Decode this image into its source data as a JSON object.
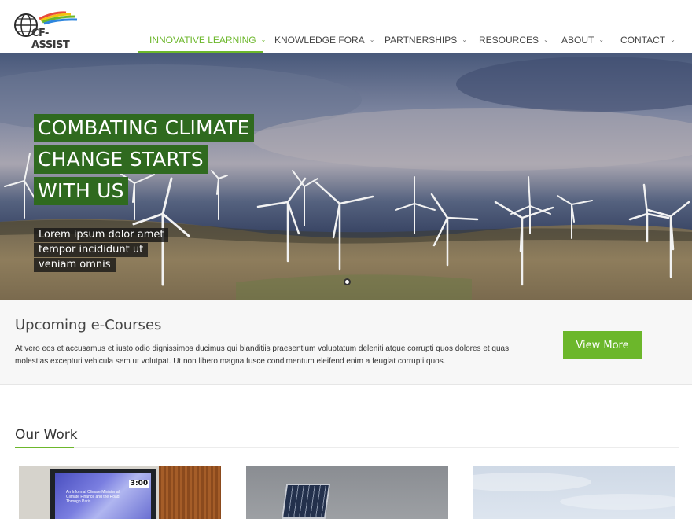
{
  "header": {
    "logo_text": "CF-ASSIST",
    "nav": [
      {
        "label": "INNOVATIVE LEARNING",
        "active": true
      },
      {
        "label": "KNOWLEDGE FORA",
        "active": false
      },
      {
        "label": "PARTNERSHIPS",
        "active": false
      },
      {
        "label": "RESOURCES",
        "active": false
      },
      {
        "label": "ABOUT",
        "active": false
      },
      {
        "label": "CONTACT",
        "active": false
      }
    ],
    "chevron_icon": "chevron-down-icon"
  },
  "hero": {
    "title_lines": [
      "COMBATING CLIMATE",
      "CHANGE STARTS",
      "WITH US"
    ],
    "subtitle_lines": [
      "Lorem ipsum dolor amet",
      "tempor incididunt ut",
      "veniam omnis"
    ],
    "slides": 1,
    "current_slide": 1
  },
  "courses": {
    "title": "Upcoming e-Courses",
    "text": "At vero eos et accusamus et iusto odio dignissimos ducimus qui blanditiis praesentium voluptatum deleniti atque corrupti quos dolores et quas molestias excepturi vehicula sem ut volutpat. Ut non libero magna fusce condimentum eleifend enim a feugiat corrupti quos.",
    "button_label": "View More"
  },
  "work": {
    "title": "Our Work",
    "cards": [
      {
        "timer": "3:00",
        "caption": "An Informal Climate Ministerial: Climate Finance and the Road Through Paris"
      },
      {},
      {}
    ]
  },
  "colors": {
    "accent": "#6cb72b",
    "hero_title_bg": "#2f6a1f",
    "hero_sub_bg": "#141414"
  }
}
